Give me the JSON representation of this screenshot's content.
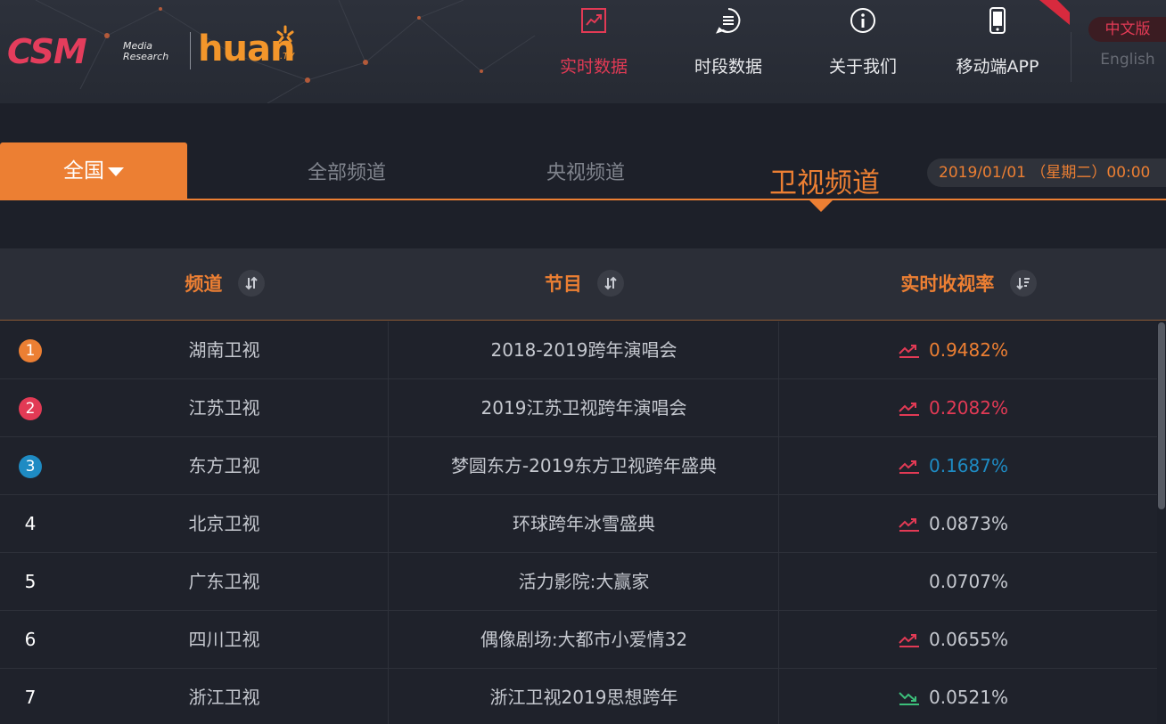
{
  "logo": {
    "brand1": "CSM",
    "brand1_sub_line1": "Media",
    "brand1_sub_line2": "Research",
    "brand2": "huan",
    "brand2_suffix": ".TV"
  },
  "nav": [
    {
      "label": "实时数据",
      "icon": "trend-chart-icon",
      "active": true
    },
    {
      "label": "时段数据",
      "icon": "message-list-icon",
      "active": false
    },
    {
      "label": "关于我们",
      "icon": "info-icon",
      "active": false
    },
    {
      "label": "移动端APP",
      "icon": "mobile-phone-icon",
      "active": false
    }
  ],
  "language": {
    "chinese": "中文版",
    "english": "English"
  },
  "region": {
    "label": "全国"
  },
  "tabs": [
    {
      "label": "全部频道",
      "active": false
    },
    {
      "label": "央视频道",
      "active": false
    },
    {
      "label": "卫视频道",
      "active": true
    }
  ],
  "datetime": "2019/01/01 （星期二）00:00",
  "table": {
    "headers": {
      "channel": "频道",
      "program": "节目",
      "rating": "实时收视率"
    },
    "rows": [
      {
        "rank": "1",
        "channel": "湖南卫视",
        "program": "2018-2019跨年演唱会",
        "rating": "0.9482%",
        "trend": "up"
      },
      {
        "rank": "2",
        "channel": "江苏卫视",
        "program": "2019江苏卫视跨年演唱会",
        "rating": "0.2082%",
        "trend": "up"
      },
      {
        "rank": "3",
        "channel": "东方卫视",
        "program": "梦圆东方-2019东方卫视跨年盛典",
        "rating": "0.1687%",
        "trend": "up"
      },
      {
        "rank": "4",
        "channel": "北京卫视",
        "program": "环球跨年冰雪盛典",
        "rating": "0.0873%",
        "trend": "up"
      },
      {
        "rank": "5",
        "channel": "广东卫视",
        "program": "活力影院:大赢家",
        "rating": "0.0707%",
        "trend": "none"
      },
      {
        "rank": "6",
        "channel": "四川卫视",
        "program": "偶像剧场:大都市小爱情32",
        "rating": "0.0655%",
        "trend": "up"
      },
      {
        "rank": "7",
        "channel": "浙江卫视",
        "program": "浙江卫视2019思想跨年",
        "rating": "0.0521%",
        "trend": "down"
      }
    ]
  },
  "colors": {
    "accent": "#ec7f33",
    "nav_active": "#e23a55",
    "rank1": "#ec7f33",
    "rank2": "#e23a55",
    "rank3": "#1e8bc3",
    "trend_up": "#e23a55",
    "trend_down": "#3cbf7a"
  }
}
